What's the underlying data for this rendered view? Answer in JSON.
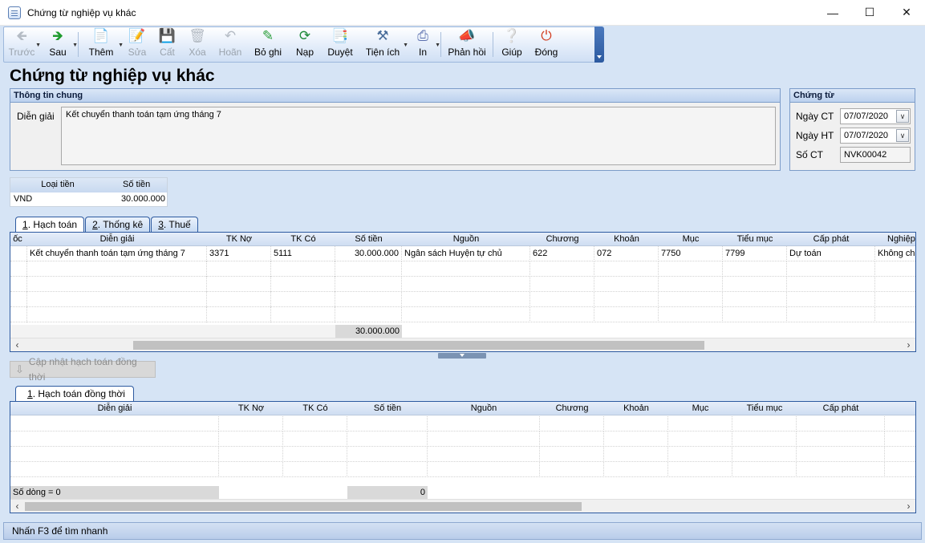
{
  "window": {
    "title": "Chứng từ nghiệp vụ khác"
  },
  "toolbar": {
    "items": [
      {
        "label": "Trước",
        "icon": "arrow-left-icon"
      },
      {
        "label": "Sau",
        "icon": "arrow-right-icon"
      },
      {
        "label": "Thêm",
        "icon": "add-document-icon"
      },
      {
        "label": "Sửa",
        "icon": "edit-icon"
      },
      {
        "label": "Cất",
        "icon": "save-icon"
      },
      {
        "label": "Xóa",
        "icon": "delete-icon"
      },
      {
        "label": "Hoãn",
        "icon": "undo-icon"
      },
      {
        "label": "Bỏ ghi",
        "icon": "unpost-icon"
      },
      {
        "label": "Nạp",
        "icon": "reload-icon"
      },
      {
        "label": "Duyệt",
        "icon": "approve-icon"
      },
      {
        "label": "Tiện ích",
        "icon": "tools-icon"
      },
      {
        "label": "In",
        "icon": "print-icon"
      },
      {
        "label": "Phản hồi",
        "icon": "megaphone-icon"
      },
      {
        "label": "Giúp",
        "icon": "help-icon"
      },
      {
        "label": "Đóng",
        "icon": "power-icon"
      }
    ]
  },
  "page": {
    "heading": "Chứng từ nghiệp vụ khác"
  },
  "general": {
    "header": "Thông tin chung",
    "description_label": "Diễn giải",
    "description_value": "Kết chuyển thanh toán tạm ứng tháng 7"
  },
  "voucher": {
    "header": "Chứng từ",
    "date_ct_label": "Ngày CT",
    "date_ct_value": "07/07/2020",
    "date_ht_label": "Ngày HT",
    "date_ht_value": "07/07/2020",
    "number_label": "Số CT",
    "number_value": "NVK00042"
  },
  "currency": {
    "col_type": "Loại tiền",
    "col_amount": "Số tiền",
    "type_value": "VND",
    "amount_value": "30.000.000"
  },
  "tabs_top": [
    {
      "key": "1",
      "rest": ". Hạch toán"
    },
    {
      "key": "2",
      "rest": ". Thống kê"
    },
    {
      "key": "3",
      "rest": ". Thuế"
    }
  ],
  "grid1": {
    "headers": [
      "ốc",
      "Diễn giải",
      "TK Nợ",
      "TK Có",
      "Số tiền",
      "Nguồn",
      "Chương",
      "Khoản",
      "Mục",
      "Tiểu mục",
      "Cấp phát",
      "Nghiệp"
    ],
    "row": {
      "description": "Kết chuyển thanh toán tạm ứng tháng 7",
      "debit": "3371",
      "credit": "5111",
      "amount": "30.000.000",
      "source": "Ngân sách Huyện tự chủ",
      "chapter": "622",
      "section": "072",
      "item": "7750",
      "subitem": "7799",
      "allocation": "Dự toán",
      "business": "Không ch"
    },
    "total_amount": "30.000.000"
  },
  "sync_button": {
    "label": "Cập nhật hạch toán đồng thời"
  },
  "tabs_bottom": [
    {
      "key": "1",
      "rest": ". Hạch toán đồng thời"
    }
  ],
  "grid2": {
    "headers": [
      "Diễn giải",
      "TK Nợ",
      "TK Có",
      "Số tiền",
      "Nguồn",
      "Chương",
      "Khoản",
      "Mục",
      "Tiểu mục",
      "Cấp phát"
    ],
    "row_count": "Số dòng = 0",
    "total_amount": "0"
  },
  "status": {
    "text": "Nhấn F3 để tìm nhanh"
  }
}
